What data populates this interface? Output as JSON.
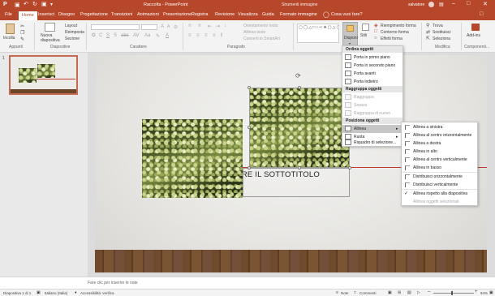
{
  "title_bar": {
    "title": "Raccolta - PowerPoint",
    "context_tab_title": "Strumenti immagine",
    "user": "salvatore"
  },
  "tabs": [
    "File",
    "Home",
    "Inserisci",
    "Disegno",
    "Progettazione",
    "Transizioni",
    "Animazioni",
    "Presentazione",
    "Registra",
    "Revisione",
    "Visualizza",
    "Guida",
    "Formato immagine"
  ],
  "active_tab": "Home",
  "tell_me": "Cosa vuoi fare?",
  "ribbon": {
    "clipboard": {
      "paste": "Incolla",
      "group": "Appunti"
    },
    "slides": {
      "new_slide": "Nuova diapositiva",
      "layout": "Layout",
      "reset": "Reimposta",
      "section": "Sezione",
      "group": "Diapositive"
    },
    "font": {
      "group": "Carattere"
    },
    "paragraph": {
      "text_direction": "Orientamento testo",
      "align_text": "Allinea testo",
      "convert_smartart": "Converti in SmartArt",
      "group": "Paragrafo"
    },
    "drawing": {
      "arrange": "Disponi",
      "quick_styles": "Stili",
      "fill": "Riempimento forma",
      "outline": "Contorno forma",
      "effects": "Effetti forma"
    },
    "editing": {
      "find": "Trova",
      "replace": "Sostituisci",
      "select": "Seleziona",
      "group": "Modifica"
    },
    "addins": {
      "addins": "Add-ins",
      "group": "Componenti..."
    }
  },
  "thumbnail": {
    "number": "1"
  },
  "slide": {
    "subtitle": "IRE IL SOTTOTITOLO"
  },
  "arrange_menu": {
    "order_header": "Ordina oggetti",
    "bring_front": "Porta in primo piano",
    "send_back": "Porta in secondo piano",
    "bring_forward": "Porta avanti",
    "send_backward": "Porta indietro",
    "group_header": "Raggruppa oggetti",
    "group": "Raggruppa",
    "ungroup": "Separa",
    "regroup": "Raggruppa di nuovo",
    "position_header": "Posiziona oggetti",
    "align": "Allinea",
    "rotate": "Ruota",
    "selection_pane": "Riquadro di selezione..."
  },
  "align_menu": {
    "items": [
      {
        "label": "Allinea a sinistra",
        "enabled": true
      },
      {
        "label": "Allinea al centro orizzontalmente",
        "enabled": true
      },
      {
        "label": "Allinea a destra",
        "enabled": true
      },
      {
        "label": "Allinea in alto",
        "enabled": true
      },
      {
        "label": "Allinea al centro verticalmente",
        "enabled": true
      },
      {
        "label": "Allinea in basso",
        "enabled": true
      },
      {
        "label": "Distribuisci orizzontalmente",
        "enabled": true
      },
      {
        "label": "Distribuisci verticalmente",
        "enabled": true
      },
      {
        "label": "Allinea rispetto alla diapositiva",
        "enabled": true,
        "checked": true
      },
      {
        "label": "Allinea oggetti selezionati",
        "enabled": false
      }
    ]
  },
  "notes": {
    "placeholder": "Fare clic per inserire le note"
  },
  "status": {
    "slide_count": "Diapositiva 1 di 1",
    "language": "Italiano (Italia)",
    "accessibility": "Accessibilità: verifica",
    "notes_btn": "Note",
    "comments_btn": "Commenti",
    "zoom": "94%"
  },
  "colors": {
    "accent": "#b7472a",
    "ribbon_bg": "#f3f3f3"
  }
}
